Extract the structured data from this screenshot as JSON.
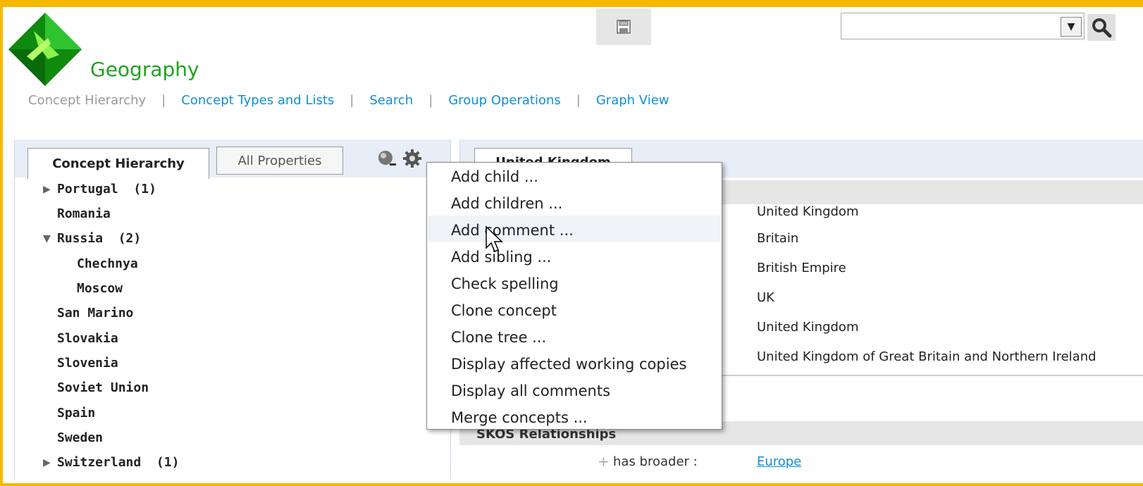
{
  "app": {
    "title": "Geography"
  },
  "nav": {
    "tabs": [
      {
        "label": "Concept Hierarchy",
        "current": true
      },
      {
        "label": "Concept Types and Lists"
      },
      {
        "label": "Search"
      },
      {
        "label": "Group Operations"
      },
      {
        "label": "Graph View"
      }
    ],
    "separator": "|"
  },
  "toolbar": {
    "save_icon": "save-icon",
    "search_icon": "search-icon",
    "dropdown_glyph": "▼",
    "search_value": ""
  },
  "left_panel": {
    "tabs": {
      "active": "Concept Hierarchy",
      "inactive": "All Properties"
    },
    "tree": [
      {
        "label": "Portugal",
        "count": "(1)",
        "arrow": "▶"
      },
      {
        "label": "Romania"
      },
      {
        "label": "Russia",
        "count": "(2)",
        "arrow": "▼"
      },
      {
        "label": "Chechnya"
      },
      {
        "label": "Moscow"
      },
      {
        "label": "San Marino"
      },
      {
        "label": "Slovakia"
      },
      {
        "label": "Slovenia"
      },
      {
        "label": "Soviet Union"
      },
      {
        "label": "Spain"
      },
      {
        "label": "Sweden"
      },
      {
        "label": "Switzerland",
        "count": "(1)",
        "arrow": "▶"
      }
    ]
  },
  "right_panel": {
    "tab_label": "United Kingdom",
    "labels": [
      "United Kingdom",
      "Britain",
      "British Empire",
      "UK",
      "United Kingdom",
      "United Kingdom of Great Britain and Northern Ireland"
    ],
    "skos": {
      "title": "SKOS Relationships",
      "relation": "has broader :",
      "value": "Europe",
      "plus": "+"
    }
  },
  "context_menu": {
    "items": [
      "Add child ...",
      "Add children ...",
      "Add comment ...",
      "Add sibling ...",
      "Check spelling",
      "Clone concept",
      "Clone tree ...",
      "Display affected working copies",
      "Display all comments",
      "Merge concepts ..."
    ],
    "highlighted_index": 2
  },
  "colors": {
    "frame": "#f5b800",
    "link": "#0f8fd6",
    "title": "#1fa31f"
  }
}
